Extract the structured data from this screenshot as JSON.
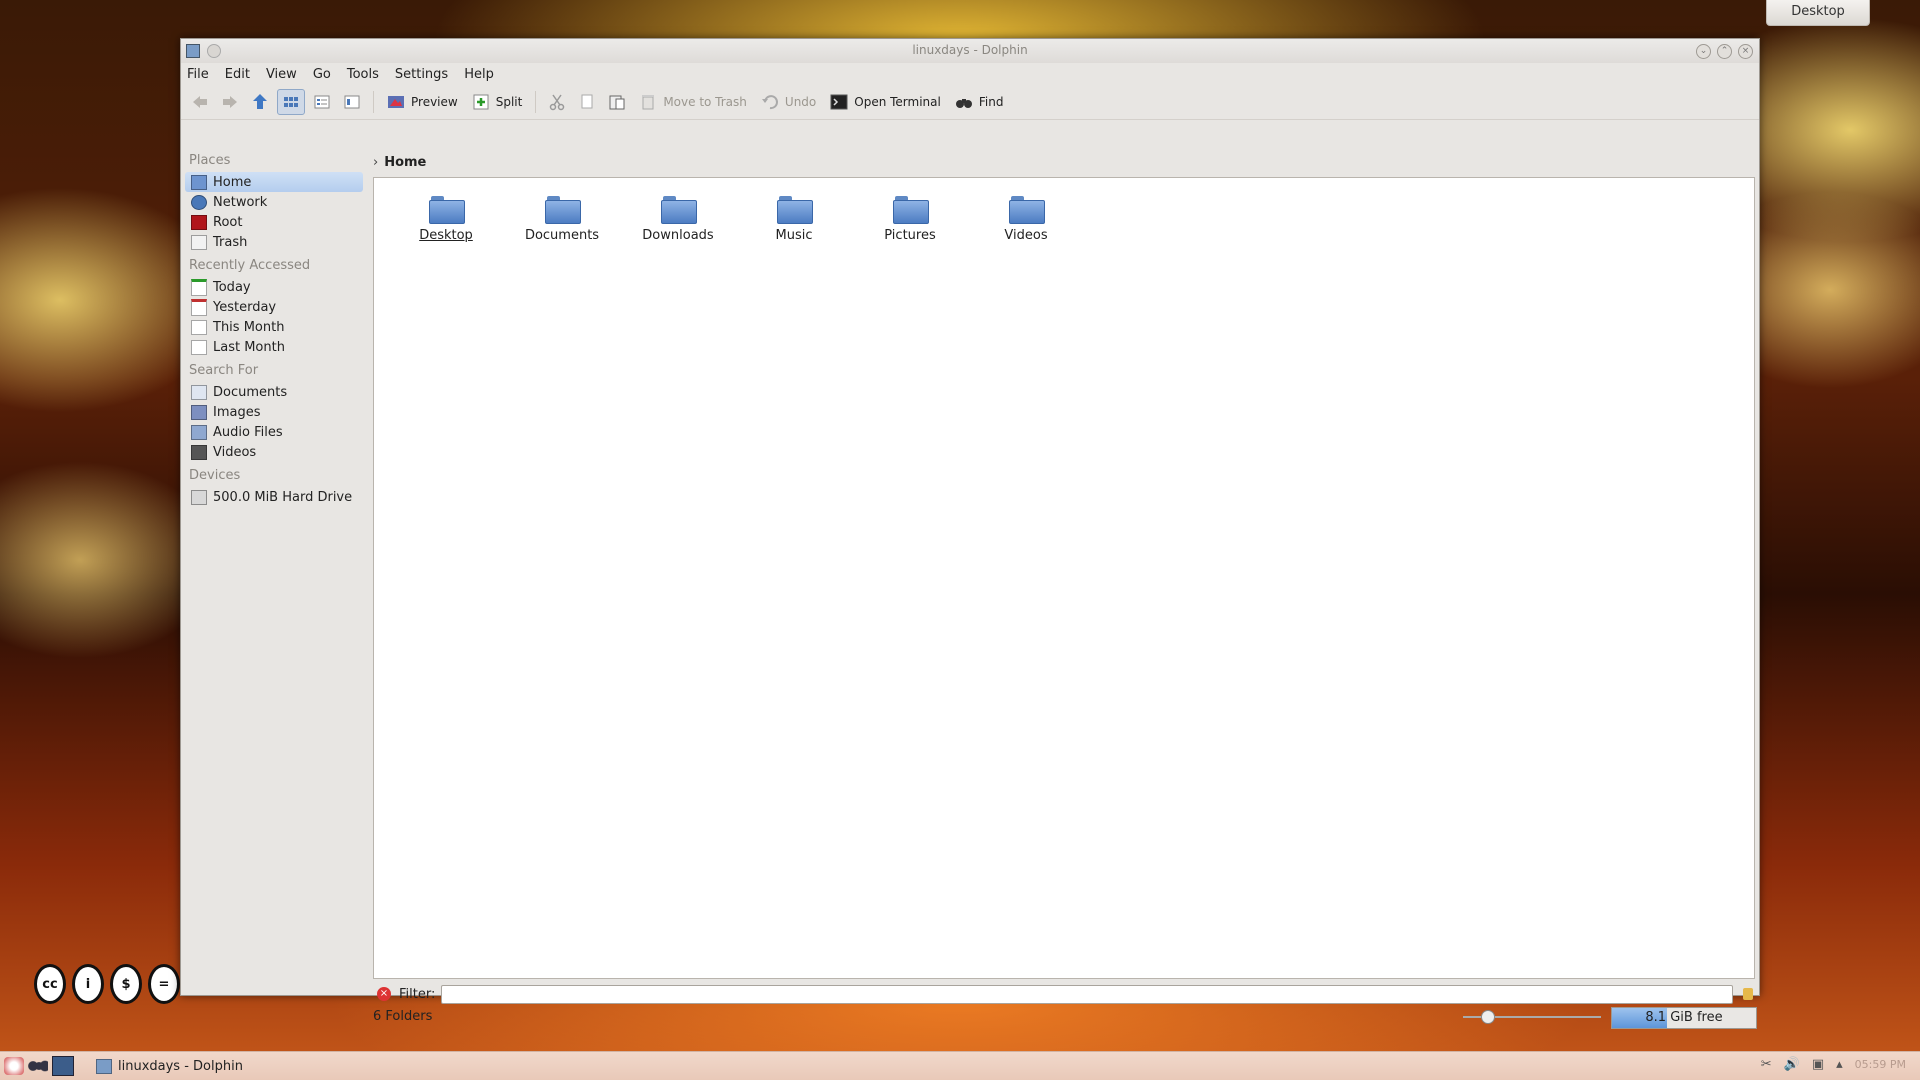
{
  "desktop": {
    "label": "Desktop"
  },
  "window": {
    "title": "linuxdays - Dolphin"
  },
  "menu": [
    "File",
    "Edit",
    "View",
    "Go",
    "Tools",
    "Settings",
    "Help"
  ],
  "toolbar": {
    "preview": "Preview",
    "split": "Split",
    "move_to_trash": "Move to Trash",
    "undo": "Undo",
    "open_terminal": "Open Terminal",
    "find": "Find"
  },
  "sidebar": {
    "places_title": "Places",
    "places": [
      {
        "label": "Home",
        "color": "#6d94cf"
      },
      {
        "label": "Network",
        "color": "#4a78b8"
      },
      {
        "label": "Root",
        "color": "#b0151b"
      },
      {
        "label": "Trash",
        "color": "#e7e7e7"
      }
    ],
    "recent_title": "Recently Accessed",
    "recent": [
      {
        "label": "Today"
      },
      {
        "label": "Yesterday"
      },
      {
        "label": "This Month"
      },
      {
        "label": "Last Month"
      }
    ],
    "search_title": "Search For",
    "search": [
      {
        "label": "Documents"
      },
      {
        "label": "Images"
      },
      {
        "label": "Audio Files"
      },
      {
        "label": "Videos"
      }
    ],
    "devices_title": "Devices",
    "devices": [
      {
        "label": "500.0 MiB Hard Drive"
      }
    ]
  },
  "breadcrumb": {
    "current": "Home"
  },
  "folders": [
    "Desktop",
    "Documents",
    "Downloads",
    "Music",
    "Pictures",
    "Videos"
  ],
  "filter": {
    "label": "Filter:",
    "value": ""
  },
  "status": {
    "count": "6 Folders",
    "free_space": "8.1 GiB free",
    "used_fraction": 0.38
  },
  "taskbar": {
    "task_title": "linuxdays - Dolphin",
    "clock": "05:59 PM"
  },
  "colors": {
    "selection": "#b4cdee",
    "folder": "#5d8ccc",
    "accent": "#5d95da"
  }
}
